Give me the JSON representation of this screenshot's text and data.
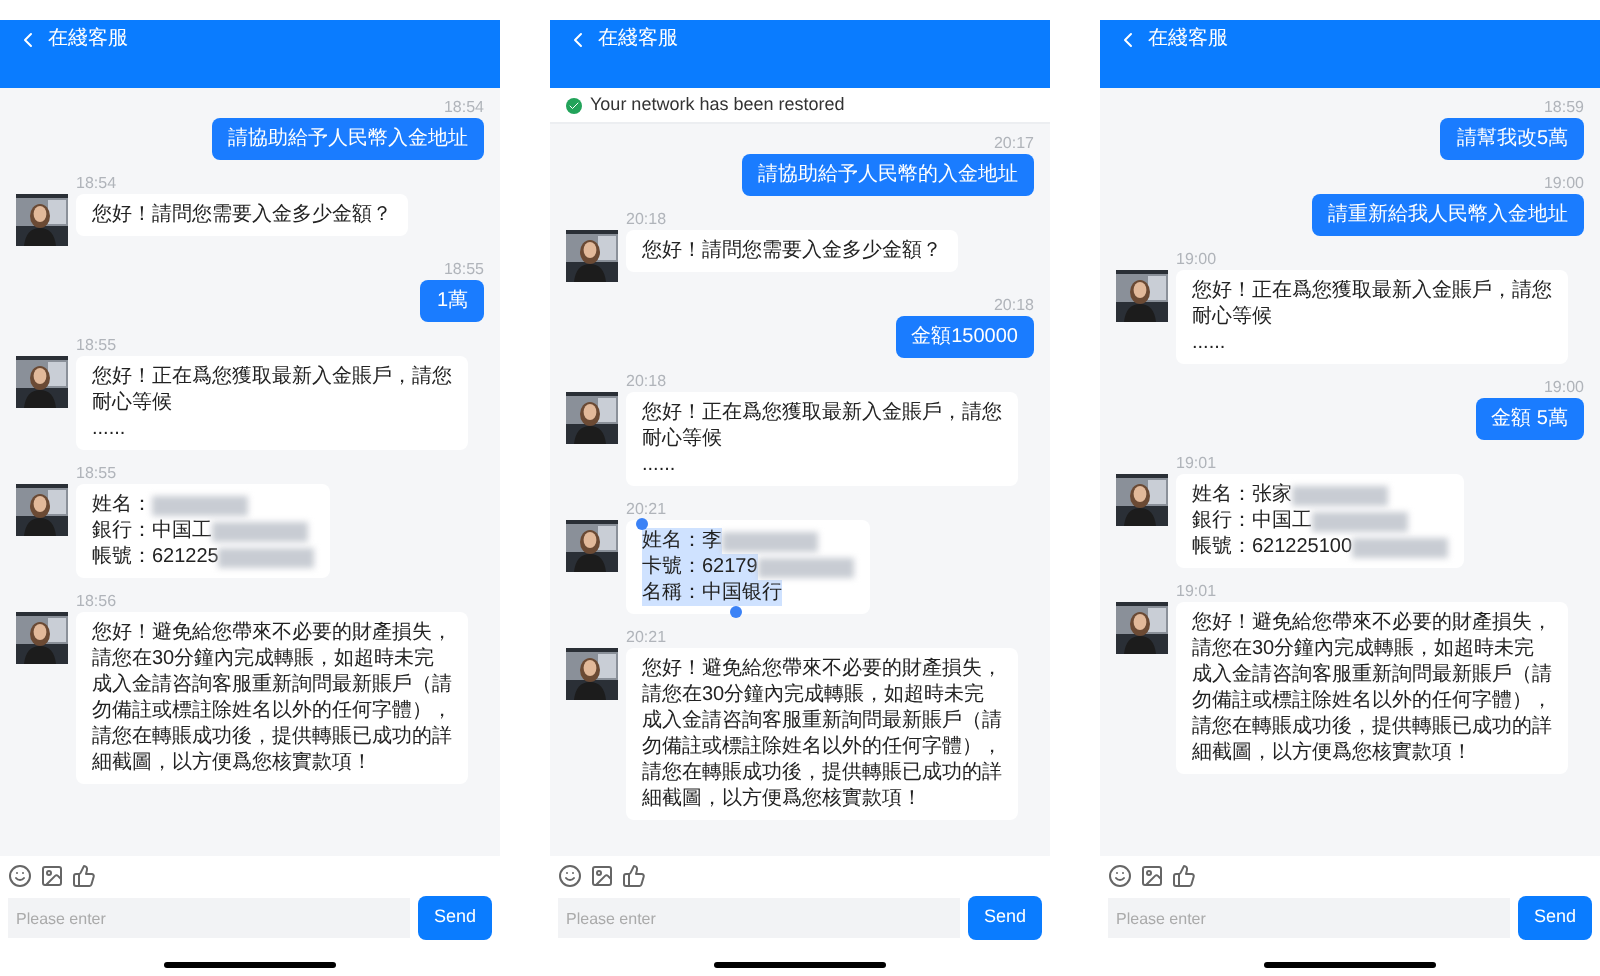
{
  "panels": [
    {
      "title": "在綫客服",
      "messages": [
        {
          "kind": "outgoing",
          "time": "18:54",
          "lines": [
            {
              "text": "請協助給予人民幣入金地址",
              "redacted": false
            }
          ],
          "selected": false
        },
        {
          "kind": "incoming",
          "time": "18:54",
          "lines": [
            {
              "text": "您好！請問您需要入金多少金額？",
              "redacted": false
            }
          ],
          "selected": false
        },
        {
          "kind": "outgoing",
          "time": "18:55",
          "lines": [
            {
              "text": "1萬",
              "redacted": false
            }
          ],
          "selected": false
        },
        {
          "kind": "incoming",
          "time": "18:55",
          "lines": [
            {
              "text": "您好！正在爲您獲取最新入金賬戶，請您耐心等候",
              "redacted": false
            },
            {
              "text": "......",
              "redacted": false
            }
          ],
          "selected": false
        },
        {
          "kind": "incoming",
          "time": "18:55",
          "lines": [
            {
              "text": "姓名：",
              "redacted": true
            },
            {
              "text": "銀行：中国工",
              "redacted": true
            },
            {
              "text": "帳號：621225",
              "redacted": true
            }
          ],
          "selected": false
        },
        {
          "kind": "incoming",
          "time": "18:56",
          "lines": [
            {
              "text": "您好！避免給您帶來不必要的財產損失，請您在30分鐘內完成轉賬，如超時未完成入金請咨詢客服重新詢問最新賬戶（請勿備註或標註除姓名以外的任何字體），請您在轉賬成功後，提供轉賬已成功的詳細截圖，以方便爲您核實款項！",
              "redacted": false
            }
          ],
          "selected": false
        }
      ],
      "input": {
        "placeholder": "Please enter"
      },
      "send": "Send"
    },
    {
      "title": "在綫客服",
      "notice": {
        "text": "Your network has been restored"
      },
      "messages": [
        {
          "kind": "outgoing",
          "time": "20:17",
          "lines": [
            {
              "text": "請協助給予人民幣的入金地址",
              "redacted": false
            }
          ],
          "selected": false
        },
        {
          "kind": "incoming",
          "time": "20:18",
          "lines": [
            {
              "text": "您好！請問您需要入金多少金額？",
              "redacted": false
            }
          ],
          "selected": false
        },
        {
          "kind": "outgoing",
          "time": "20:18",
          "lines": [
            {
              "text": "金額150000",
              "redacted": false
            }
          ],
          "selected": false
        },
        {
          "kind": "incoming",
          "time": "20:18",
          "lines": [
            {
              "text": "您好！正在爲您獲取最新入金賬戶，請您耐心等候",
              "redacted": false
            },
            {
              "text": "......",
              "redacted": false
            }
          ],
          "selected": false
        },
        {
          "kind": "incoming",
          "time": "20:21",
          "lines": [
            {
              "text": "姓名：李",
              "redacted": true
            },
            {
              "text": "卡號：62179",
              "redacted": true
            },
            {
              "text": "名稱：中国银行",
              "redacted": false
            }
          ],
          "selected": true
        },
        {
          "kind": "incoming",
          "time": "20:21",
          "lines": [
            {
              "text": "您好！避免給您帶來不必要的財產損失，請您在30分鐘內完成轉賬，如超時未完成入金請咨詢客服重新詢問最新賬戶（請勿備註或標註除姓名以外的任何字體），請您在轉賬成功後，提供轉賬已成功的詳細截圖，以方便爲您核實款項！",
              "redacted": false
            }
          ],
          "selected": false
        }
      ],
      "input": {
        "placeholder": "Please enter"
      },
      "send": "Send"
    },
    {
      "title": "在綫客服",
      "messages": [
        {
          "kind": "outgoing",
          "time": "18:59",
          "lines": [
            {
              "text": "請幫我改5萬",
              "redacted": false
            }
          ],
          "selected": false
        },
        {
          "kind": "outgoing",
          "time": "19:00",
          "lines": [
            {
              "text": "請重新給我人民幣入金地址",
              "redacted": false
            }
          ],
          "selected": false
        },
        {
          "kind": "incoming",
          "time": "19:00",
          "lines": [
            {
              "text": "您好！正在爲您獲取最新入金賬戶，請您耐心等候",
              "redacted": false
            },
            {
              "text": "......",
              "redacted": false
            }
          ],
          "selected": false
        },
        {
          "kind": "outgoing",
          "time": "19:00",
          "lines": [
            {
              "text": "金額 5萬",
              "redacted": false
            }
          ],
          "selected": false
        },
        {
          "kind": "incoming",
          "time": "19:01",
          "lines": [
            {
              "text": "姓名：张家",
              "redacted": true
            },
            {
              "text": "銀行：中国工",
              "redacted": true
            },
            {
              "text": "帳號：621225100",
              "redacted": true
            }
          ],
          "selected": false
        },
        {
          "kind": "incoming",
          "time": "19:01",
          "lines": [
            {
              "text": "您好！避免給您帶來不必要的財產損失，請您在30分鐘內完成轉賬，如超時未完成入金請咨詢客服重新詢問最新賬戶（請勿備註或標註除姓名以外的任何字體），請您在轉賬成功後，提供轉賬已成功的詳細截圖，以方便爲您核實款項！",
              "redacted": false
            }
          ],
          "selected": false
        }
      ],
      "input": {
        "placeholder": "Please enter"
      },
      "send": "Send"
    }
  ]
}
